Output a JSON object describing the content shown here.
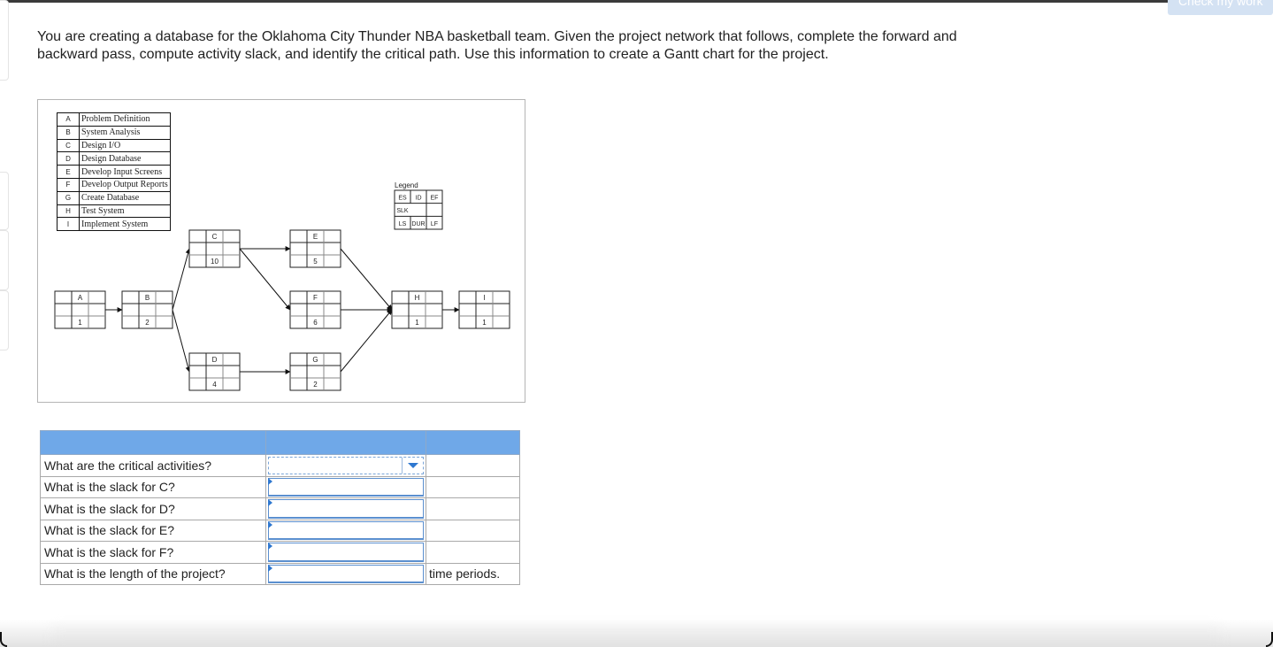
{
  "header": {
    "check_button_label": "Check my work"
  },
  "prompt": {
    "text": "You are creating a database for the Oklahoma City Thunder NBA basketball team. Given the project network that follows, complete the forward and backward pass, compute activity slack, and identify the critical path. Use this information to create a Gantt chart for the project."
  },
  "figure": {
    "activities": [
      {
        "code": "A",
        "name": "Problem Definition"
      },
      {
        "code": "B",
        "name": "System Analysis"
      },
      {
        "code": "C",
        "name": "Design I/O"
      },
      {
        "code": "D",
        "name": "Design Database"
      },
      {
        "code": "E",
        "name": "Develop Input Screens"
      },
      {
        "code": "F",
        "name": "Develop Output Reports"
      },
      {
        "code": "G",
        "name": "Create Database"
      },
      {
        "code": "H",
        "name": "Test System"
      },
      {
        "code": "I",
        "name": "Implement  System"
      }
    ],
    "legend": {
      "title": "Legend",
      "es": "ES",
      "id": "ID",
      "ef": "EF",
      "slk": "SLK",
      "ls": "LS",
      "dur": "DUR",
      "lf": "LF"
    },
    "nodes": [
      {
        "id": "A",
        "duration": "1"
      },
      {
        "id": "B",
        "duration": "2"
      },
      {
        "id": "C",
        "duration": "10"
      },
      {
        "id": "D",
        "duration": "4"
      },
      {
        "id": "E",
        "duration": "5"
      },
      {
        "id": "F",
        "duration": "6"
      },
      {
        "id": "G",
        "duration": "2"
      },
      {
        "id": "H",
        "duration": "1"
      },
      {
        "id": "I",
        "duration": "1"
      }
    ],
    "edges": [
      [
        "A",
        "B"
      ],
      [
        "B",
        "C"
      ],
      [
        "B",
        "D"
      ],
      [
        "C",
        "E"
      ],
      [
        "C",
        "F"
      ],
      [
        "D",
        "G"
      ],
      [
        "E",
        "H"
      ],
      [
        "F",
        "H"
      ],
      [
        "G",
        "H"
      ],
      [
        "H",
        "I"
      ]
    ]
  },
  "questions": {
    "rows": [
      {
        "question": "What are the critical activities?",
        "input_type": "select",
        "value": "",
        "unit": ""
      },
      {
        "question": "What is the slack for C?",
        "input_type": "text",
        "value": "",
        "unit": ""
      },
      {
        "question": "What is the slack for D?",
        "input_type": "text",
        "value": "",
        "unit": ""
      },
      {
        "question": "What is the slack for E?",
        "input_type": "text",
        "value": "",
        "unit": ""
      },
      {
        "question": "What is the slack for F?",
        "input_type": "text",
        "value": "",
        "unit": ""
      },
      {
        "question": "What is the length of the project?",
        "input_type": "text",
        "value": "",
        "unit": "time periods."
      }
    ]
  },
  "colors": {
    "header_blue": "#6fa8e8",
    "input_border": "#5b8fcf",
    "accent": "#2f78d0"
  }
}
